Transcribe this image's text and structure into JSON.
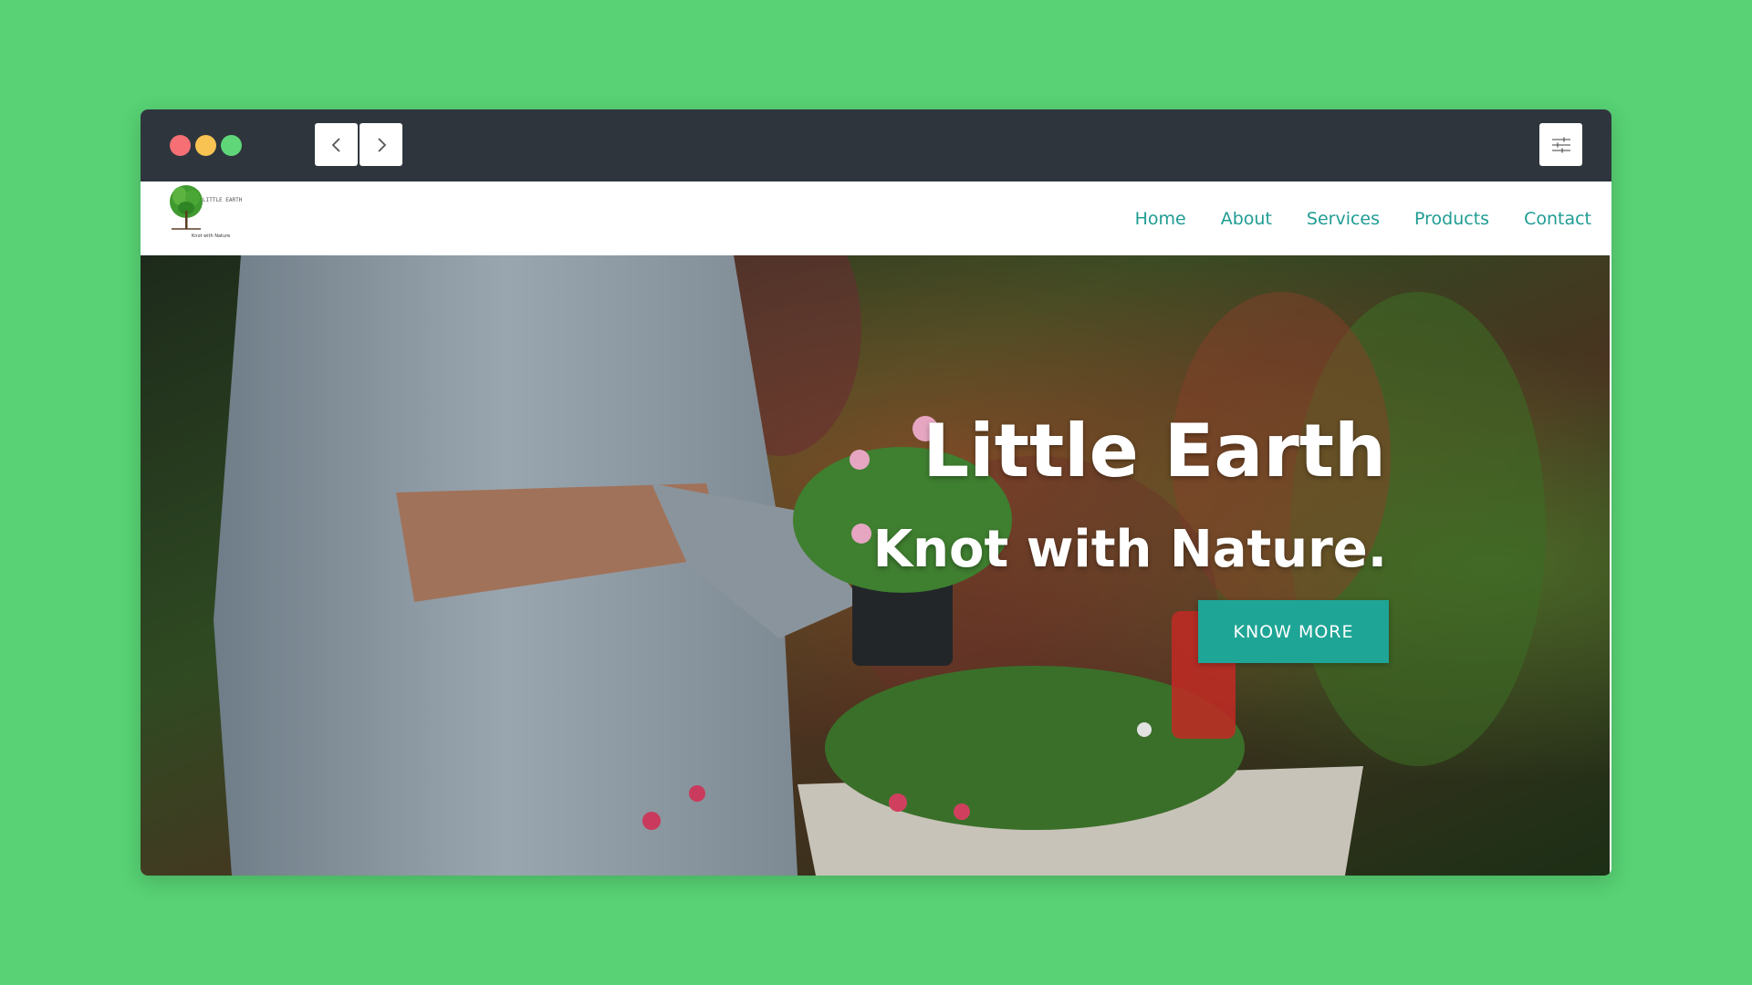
{
  "site": {
    "logo_alt": "Little Earth logo",
    "logo_text": "LITTLE EARTH",
    "logo_tagline": "Knot with Nature"
  },
  "nav": {
    "items": [
      {
        "label": "Home"
      },
      {
        "label": "About"
      },
      {
        "label": "Services"
      },
      {
        "label": "Products"
      },
      {
        "label": "Contact"
      }
    ]
  },
  "hero": {
    "title": "Little Earth",
    "subtitle": "Knot with Nature.",
    "cta_label": "KNOW MORE"
  },
  "colors": {
    "page_background": "#58d274",
    "chrome": "#2e353d",
    "accent": "#1fa596",
    "nav_text": "#1f9c93"
  },
  "icons": {
    "back": "chevron-left-icon",
    "forward": "chevron-right-icon",
    "menu": "sliders-icon"
  }
}
